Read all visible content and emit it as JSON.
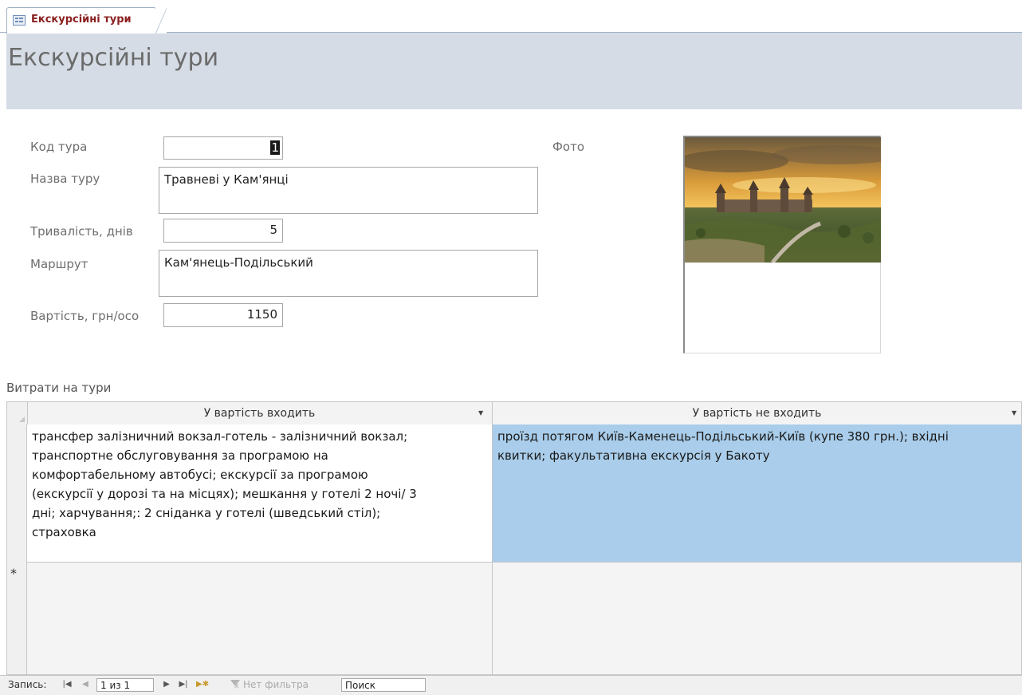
{
  "tab": {
    "label": "Екскурсійні тури",
    "icon": "form-icon"
  },
  "header": {
    "title": "Екскурсійні тури"
  },
  "fields": {
    "code": {
      "label": "Код тура",
      "value": "1"
    },
    "name": {
      "label": "Назва туру",
      "value": "Травневі у Кам'янці"
    },
    "duration": {
      "label": "Тривалість, днів",
      "value": "5"
    },
    "route": {
      "label": "Маршрут",
      "value": "Кам'янець-Подільський"
    },
    "price": {
      "label": "Вартість, грн/осо",
      "value": "1150"
    },
    "photo": {
      "label": "Фото"
    }
  },
  "subform": {
    "label": "Витрати на тури",
    "columns": [
      "У вартість входить",
      "У вартість не входить"
    ],
    "rows": [
      {
        "included": "трансфер залізничний вокзал-готель - залізничний вокзал;\nтранспортне обслуговування за програмою на\nкомфортабельному автобусі; екскурсії за програмою\n(екскурсії у дорозі та на місцях); мешкання у готелі 2 ночі/ 3\nдні; харчування;: 2 сніданка у готелі (шведський  стіл);\nстраховка",
        "excluded": "проїзд потягом Київ-Каменець-Подільський-Київ (купе 380 грн.); вхідні\nквитки; факультативна екскурсія у Бакоту"
      }
    ],
    "new_row_marker": "*"
  },
  "navigation": {
    "record_label": "Запись:",
    "position": "1 из 1",
    "filter_label": "Нет фильтра",
    "search_label": "Поиск"
  },
  "colors": {
    "header_bg": "#d5dce5",
    "selected_cell_bg": "#a9cdea",
    "tab_label": "#8b2020"
  }
}
